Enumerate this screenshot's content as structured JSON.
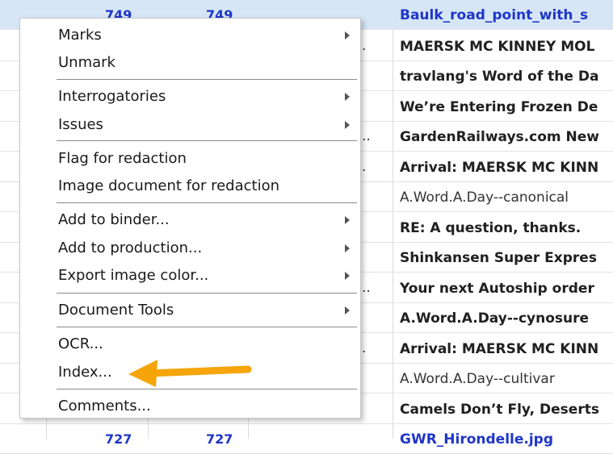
{
  "grid": {
    "top_row": {
      "col1": "749",
      "col2": "749",
      "subject": "Baulk_road_point_with_s"
    },
    "bottom_row": {
      "col1": "727",
      "col2": "727",
      "subject": "GWR_Hirondelle.jpg"
    },
    "subjects": [
      "MAERSK MC KINNEY MOL",
      "travlang's Word of the Da",
      "We’re Entering Frozen De",
      "GardenRailways.com New",
      "Arrival: MAERSK MC KINN",
      "A.Word.A.Day--canonical",
      "RE: A question, thanks.",
      "Shinkansen Super Expres",
      "Your next Autoship order",
      "A.Word.A.Day--cynosure",
      "Arrival: MAERSK MC KINN",
      "A.Word.A.Day--cultivar",
      "Camels Don’t Fly, Deserts"
    ],
    "ellipsis": ".",
    "ellipsis_double": ".."
  },
  "menu": {
    "marks": "Marks",
    "unmark": "Unmark",
    "interrogatories": "Interrogatories",
    "issues": "Issues",
    "flag_redaction": "Flag for redaction",
    "image_redaction": "Image document for redaction",
    "add_binder": "Add to binder...",
    "add_production": "Add to production...",
    "export_color": "Export image color...",
    "document_tools": "Document Tools",
    "ocr": "OCR...",
    "index": "Index...",
    "comments": "Comments..."
  },
  "colors": {
    "pointer_arrow": "#f5a50a",
    "link_blue": "#1f36c7",
    "selected_row": "#d6e6f7"
  }
}
